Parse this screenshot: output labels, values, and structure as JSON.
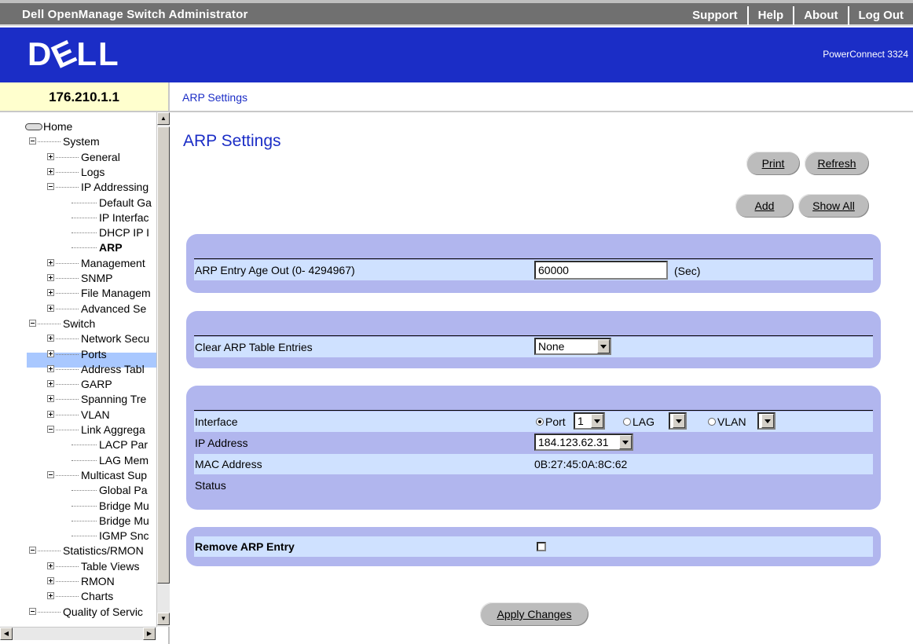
{
  "app": {
    "title": "Dell OpenManage Switch Administrator",
    "nav": [
      "Support",
      "Help",
      "About",
      "Log Out"
    ],
    "logo_text": "DELL",
    "product": "PowerConnect 3324"
  },
  "device": {
    "ip": "176.210.1.1"
  },
  "breadcrumb": "ARP Settings",
  "tree": {
    "items": [
      {
        "label": "Home"
      },
      {
        "label": "System"
      },
      {
        "label": "General"
      },
      {
        "label": "Logs"
      },
      {
        "label": "IP Addressing"
      },
      {
        "label": "Default Ga"
      },
      {
        "label": "IP Interfac"
      },
      {
        "label": "DHCP IP I"
      },
      {
        "label": "ARP"
      },
      {
        "label": "Management"
      },
      {
        "label": "SNMP"
      },
      {
        "label": "File Managem"
      },
      {
        "label": "Advanced Se"
      },
      {
        "label": "Switch"
      },
      {
        "label": "Network Secu"
      },
      {
        "label": "Ports"
      },
      {
        "label": "Address Tabl"
      },
      {
        "label": "GARP"
      },
      {
        "label": "Spanning Tre"
      },
      {
        "label": "VLAN"
      },
      {
        "label": "Link Aggrega"
      },
      {
        "label": "LACP Par"
      },
      {
        "label": "LAG Mem"
      },
      {
        "label": "Multicast Sup"
      },
      {
        "label": "Global Pa"
      },
      {
        "label": "Bridge Mu"
      },
      {
        "label": "Bridge Mu"
      },
      {
        "label": "IGMP Snc"
      },
      {
        "label": "Statistics/RMON"
      },
      {
        "label": "Table Views"
      },
      {
        "label": "RMON"
      },
      {
        "label": "Charts"
      },
      {
        "label": "Quality of Servic"
      }
    ]
  },
  "page": {
    "title": "ARP Settings",
    "buttons": {
      "print": "Print",
      "refresh": "Refresh",
      "add": "Add",
      "show_all": "Show All",
      "apply": "Apply Changes"
    },
    "age_out": {
      "label": "ARP Entry Age Out (0- 4294967)",
      "value": "60000",
      "unit": "(Sec)"
    },
    "clear": {
      "label": "Clear ARP Table Entries",
      "value": "None"
    },
    "interface": {
      "label": "Interface",
      "port_label": "Port",
      "port_value": "1",
      "lag_label": "LAG",
      "vlan_label": "VLAN",
      "selected": "Port"
    },
    "ip": {
      "label": "IP Address",
      "value": "184.123.62.31"
    },
    "mac": {
      "label": "MAC Address",
      "value": "0B:27:45:0A:8C:62"
    },
    "status": {
      "label": "Status",
      "value": ""
    },
    "remove": {
      "label": "Remove ARP Entry",
      "checked": false
    }
  }
}
